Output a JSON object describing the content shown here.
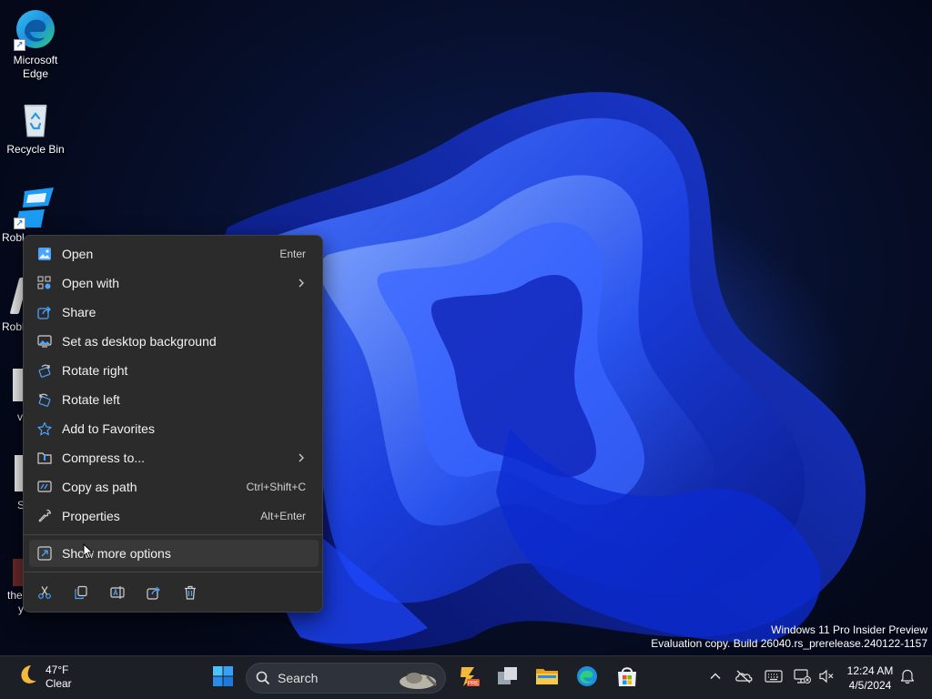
{
  "desktop_icons": [
    {
      "name": "edge",
      "label_line1": "Microsoft",
      "label_line2": "Edge"
    },
    {
      "name": "recycle-bin",
      "label_line1": "Recycle Bin"
    },
    {
      "name": "roblox-studio",
      "label_fragment": "Robl"
    },
    {
      "name": "roblox",
      "label_fragment": "Robl"
    },
    {
      "name": "doc-1",
      "label_fragment": "v"
    },
    {
      "name": "doc-2",
      "label_fragment": "S"
    },
    {
      "name": "image-file",
      "label_fragment": "the",
      "label_fragment2": "y"
    }
  ],
  "context_menu": {
    "items": [
      {
        "label": "Open",
        "shortcut": "Enter",
        "icon": "image-open-icon"
      },
      {
        "label": "Open with",
        "shortcut": "",
        "icon": "open-with-icon",
        "submenu": true
      },
      {
        "label": "Share",
        "shortcut": "",
        "icon": "share-icon"
      },
      {
        "label": "Set as desktop background",
        "shortcut": "",
        "icon": "desktop-background-icon"
      },
      {
        "label": "Rotate right",
        "shortcut": "",
        "icon": "rotate-right-icon"
      },
      {
        "label": "Rotate left",
        "shortcut": "",
        "icon": "rotate-left-icon"
      },
      {
        "label": "Add to Favorites",
        "shortcut": "",
        "icon": "star-icon"
      },
      {
        "label": "Compress to...",
        "shortcut": "",
        "icon": "zip-folder-icon",
        "submenu": true
      },
      {
        "label": "Copy as path",
        "shortcut": "Ctrl+Shift+C",
        "icon": "copy-path-icon"
      },
      {
        "label": "Properties",
        "shortcut": "Alt+Enter",
        "icon": "wrench-icon"
      }
    ],
    "more_options": {
      "label": "Show more options",
      "icon": "more-options-icon"
    },
    "toolbar": [
      "cut-icon",
      "copy-icon",
      "rename-icon",
      "share-icon",
      "delete-icon"
    ]
  },
  "watermark": {
    "line1": "Windows 11 Pro Insider Preview",
    "line2": "Evaluation copy. Build 26040.rs_prerelease.240122-1157"
  },
  "taskbar": {
    "weather": {
      "temp": "47°F",
      "condition": "Clear",
      "icon": "moon-icon"
    },
    "search_label": "Search",
    "apps": [
      "windows-start-icon",
      "search-icon",
      "app-pre-icon",
      "task-view-icon",
      "file-explorer-icon",
      "edge-icon",
      "store-icon"
    ],
    "tray_icons": [
      "chevron-up-icon",
      "onedrive-icon",
      "keyboard-icon",
      "network-icon",
      "volume-mute-icon",
      "notification-bell-icon"
    ],
    "clock": {
      "time": "12:24 AM",
      "date": "4/5/2024"
    }
  },
  "colors": {
    "menu_bg": "#2b2b2b",
    "accent_blue": "#4aa3ff",
    "taskbar_bg": "#1c1f26"
  }
}
